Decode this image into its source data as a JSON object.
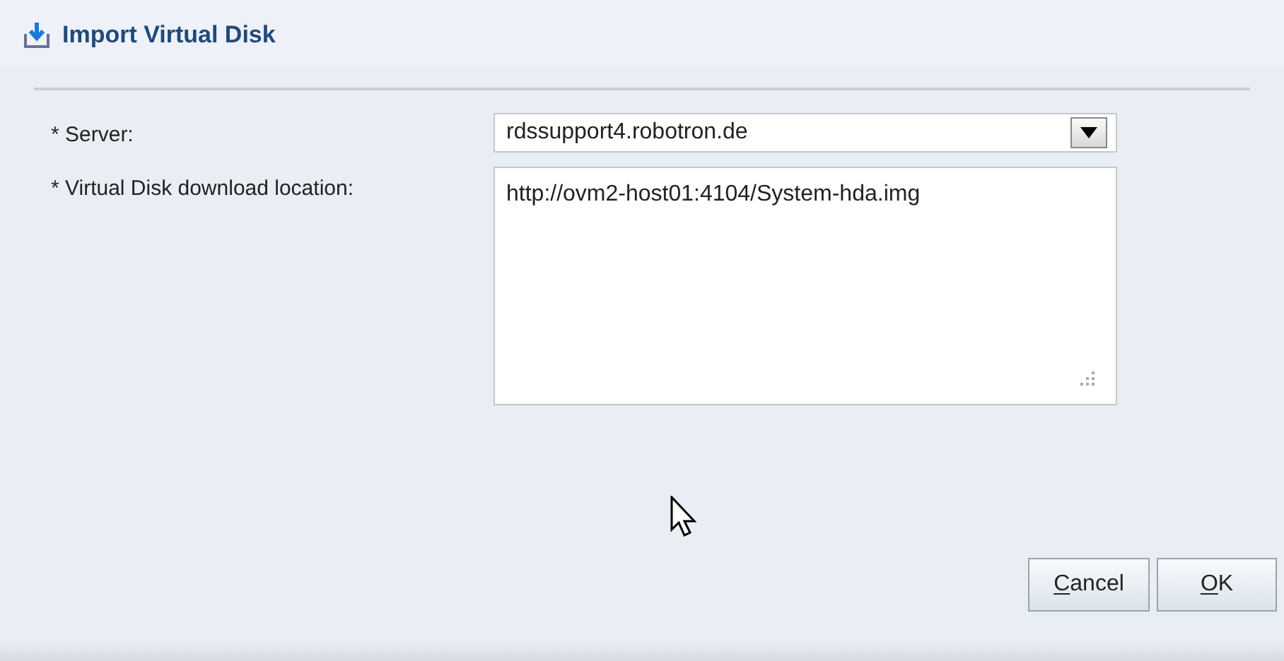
{
  "dialog": {
    "title": "Import Virtual Disk"
  },
  "fields": [
    {
      "kind": "select",
      "label": "* Server:",
      "value": "rdssupport4.robotron.de"
    },
    {
      "kind": "textarea",
      "label": "* Virtual Disk download location:",
      "value": "http://ovm2-host01:4104/System-hda.img"
    }
  ],
  "buttons": [
    {
      "label": "Cancel",
      "mnemonic_underlined": true
    },
    {
      "label": "OK",
      "mnemonic_underlined": true
    }
  ]
}
